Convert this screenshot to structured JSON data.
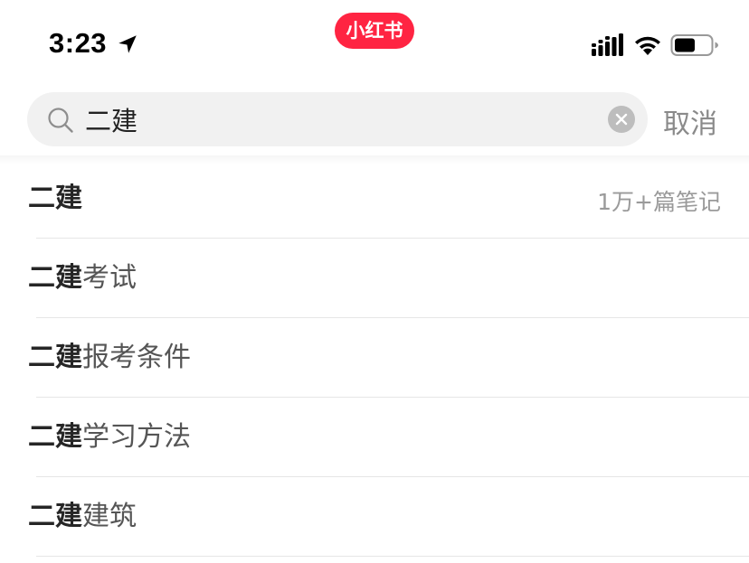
{
  "status_bar": {
    "time": "3:23",
    "app_badge": "小红书",
    "icons": [
      "location-arrow-icon",
      "cellular-signal-icon",
      "wifi-icon",
      "battery-icon"
    ]
  },
  "colors": {
    "brand": "#ff2442",
    "search_bg": "#f1f1f1",
    "muted_text": "#9a9a9a"
  },
  "search": {
    "value": "二建",
    "placeholder": "",
    "cancel_label": "取消"
  },
  "suggestions": [
    {
      "keyword": "二建",
      "suffix": "",
      "meta": "1万+篇笔记"
    },
    {
      "keyword": "二建",
      "suffix": "考试",
      "meta": ""
    },
    {
      "keyword": "二建",
      "suffix": "报考条件",
      "meta": ""
    },
    {
      "keyword": "二建",
      "suffix": "学习方法",
      "meta": ""
    },
    {
      "keyword": "二建",
      "suffix": "建筑",
      "meta": ""
    }
  ]
}
